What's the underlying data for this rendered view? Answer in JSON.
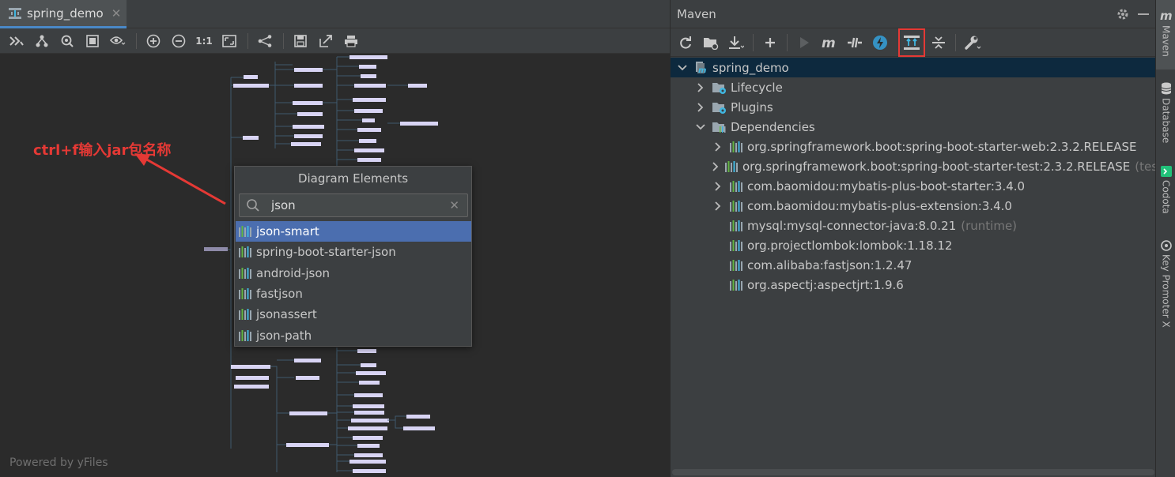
{
  "editor": {
    "tab_label": "spring_demo",
    "tab_close": "✕",
    "zoom_actual_label": "1:1"
  },
  "annotation": {
    "text": "ctrl+f输入jar包名称",
    "color": "#e53935"
  },
  "popup": {
    "title": "Diagram Elements",
    "search_value": "json",
    "clear_glyph": "✕",
    "items": [
      {
        "label": "json-smart",
        "selected": true
      },
      {
        "label": "spring-boot-starter-json",
        "selected": false
      },
      {
        "label": "android-json",
        "selected": false
      },
      {
        "label": "fastjson",
        "selected": false
      },
      {
        "label": "jsonassert",
        "selected": false
      },
      {
        "label": "json-path",
        "selected": false
      }
    ]
  },
  "canvas": {
    "powered_by": "Powered by yFiles"
  },
  "maven": {
    "title": "Maven",
    "tree": {
      "root": "spring_demo",
      "lifecycle": "Lifecycle",
      "plugins": "Plugins",
      "dependencies": "Dependencies",
      "deps": [
        {
          "label": "org.springframework.boot:spring-boot-starter-web:2.3.2.RELEASE",
          "scope": "",
          "expandable": true
        },
        {
          "label": "org.springframework.boot:spring-boot-starter-test:2.3.2.RELEASE",
          "scope": "(test",
          "expandable": true
        },
        {
          "label": "com.baomidou:mybatis-plus-boot-starter:3.4.0",
          "scope": "",
          "expandable": true
        },
        {
          "label": "com.baomidou:mybatis-plus-extension:3.4.0",
          "scope": "",
          "expandable": true
        },
        {
          "label": "mysql:mysql-connector-java:8.0.21",
          "scope": "(runtime)",
          "expandable": false
        },
        {
          "label": "org.projectlombok:lombok:1.18.12",
          "scope": "",
          "expandable": false
        },
        {
          "label": "com.alibaba:fastjson:1.2.47",
          "scope": "",
          "expandable": false
        },
        {
          "label": "org.aspectj:aspectjrt:1.9.6",
          "scope": "",
          "expandable": false
        }
      ]
    }
  },
  "sidebar": {
    "maven": "Maven",
    "database": "Database",
    "codota": "Codota",
    "key_promoter": "Key Promoter X"
  },
  "colors": {
    "accent": "#4b6eaf",
    "highlight_box": "#e53935",
    "node_fill": "#d8d4f4"
  }
}
